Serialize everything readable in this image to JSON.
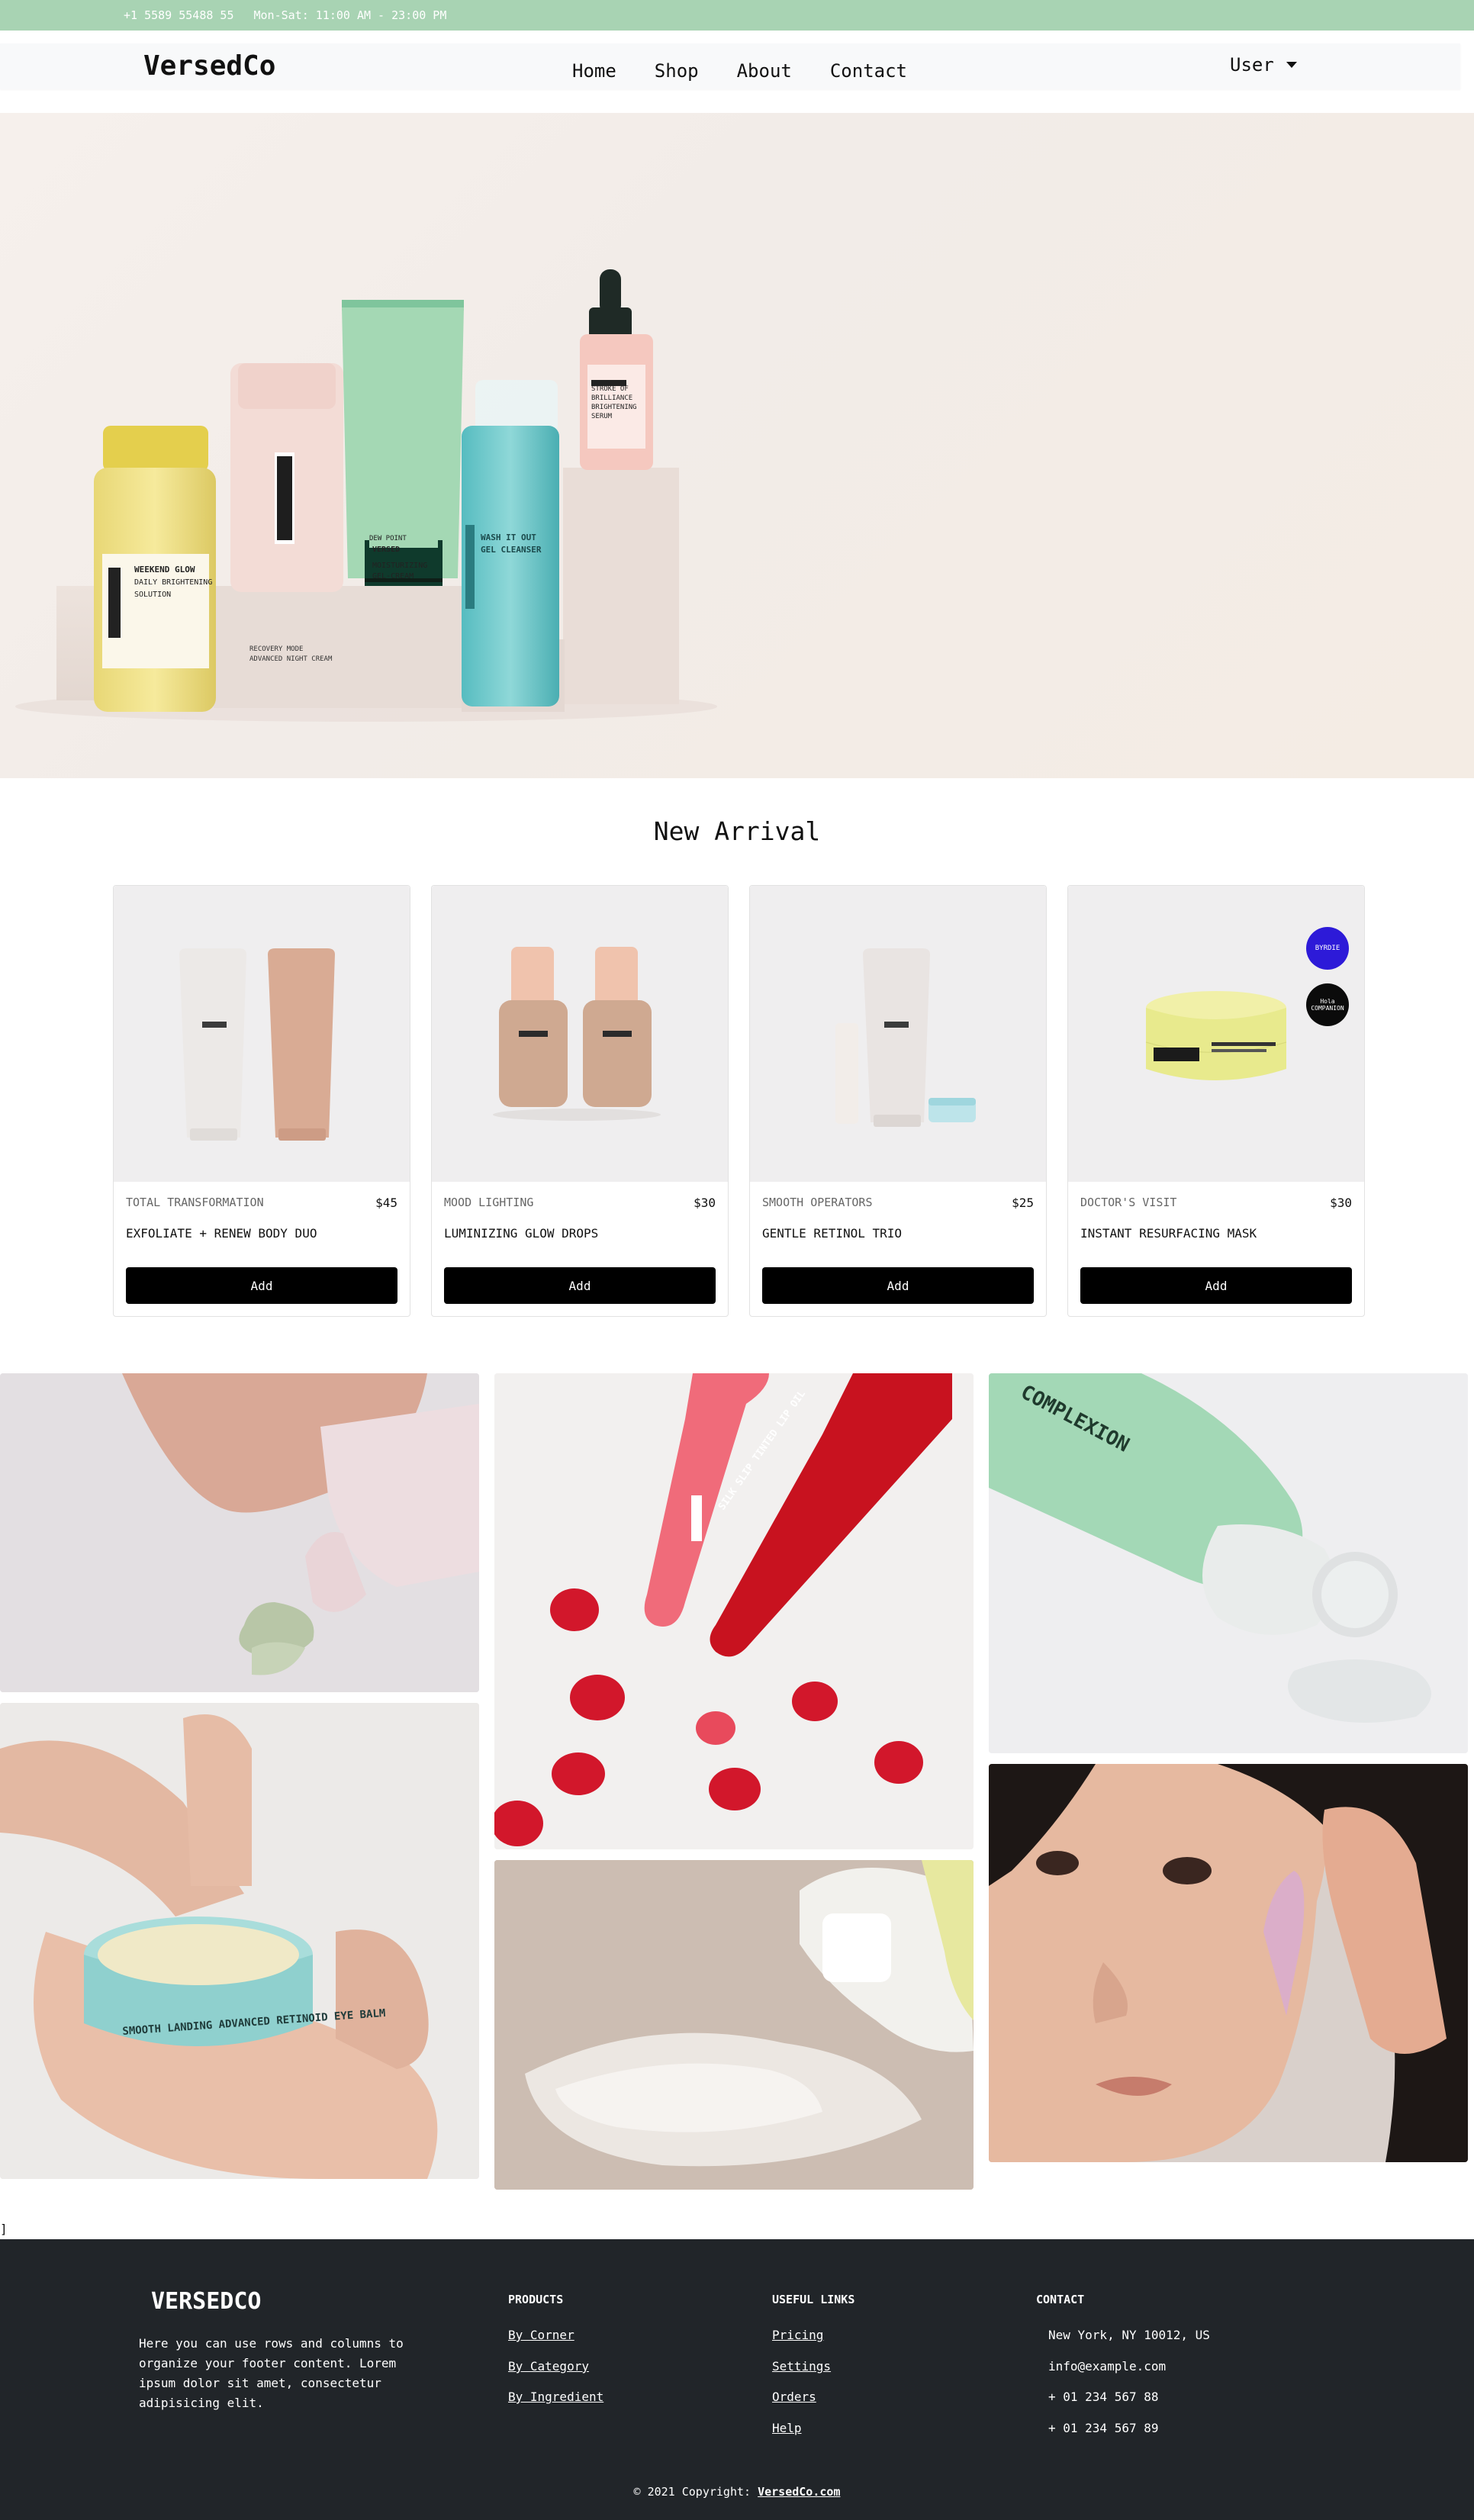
{
  "topbar": {
    "phone": "+1 5589 55488 55",
    "hours": "Mon-Sat: 11:00 AM - 23:00 PM"
  },
  "navbar": {
    "brand": "VersedCo",
    "links": [
      "Home",
      "Shop",
      "About",
      "Contact"
    ],
    "user_label": "User"
  },
  "new_arrival": {
    "title": "New Arrival",
    "products": [
      {
        "category": "TOTAL TRANSFORMATION",
        "price": "$45",
        "name": "EXFOLIATE + RENEW BODY DUO",
        "button": "Add"
      },
      {
        "category": "MOOD LIGHTING",
        "price": "$30",
        "name": "LUMINIZING GLOW DROPS",
        "button": "Add"
      },
      {
        "category": "SMOOTH OPERATORS",
        "price": "$25",
        "name": "GENTLE RETINOL TRIO",
        "button": "Add"
      },
      {
        "category": "DOCTOR'S VISIT",
        "price": "$30",
        "name": "INSTANT RESURFACING MASK",
        "button": "Add"
      }
    ]
  },
  "product_labels": {
    "brand": "VERSED",
    "hero_1": "WEEKEND GLOW DAILY BRIGHTENING SOLUTION",
    "hero_2": "RECOVERY MODE ADVANCED NIGHT CREAM",
    "hero_3": "DEW POINT MOISTURIZING GEL-CREAM",
    "hero_4": "WASH IT OUT GEL CLEANSER",
    "hero_5": "STROKE OF BRILLIANCE BRIGHTENING SERUM",
    "lip": "SILK SLIP TINTED LIP OIL",
    "eye_balm": "SMOOTH LANDING ADVANCED RETINOID EYE BALM",
    "complexion": "COMPLEXION",
    "mask_label": "INSTANT RESURFACING MASK",
    "award_1": "BYRDIE",
    "award_2": "Hola COMPANION"
  },
  "stray_text": "]",
  "footer": {
    "brand": "VERSEDCO",
    "about": "Here you can use rows and columns to organize your footer content. Lorem ipsum dolor sit amet, consectetur adipisicing elit.",
    "products_title": "PRODUCTS",
    "products": [
      "By Corner",
      "By Category",
      "By Ingredient"
    ],
    "useful_title": "USEFUL LINKS",
    "useful": [
      "Pricing",
      "Settings",
      "Orders",
      "Help"
    ],
    "contact_title": "CONTACT",
    "contact": [
      "New York, NY 10012, US",
      "info@example.com",
      "+ 01 234 567 88",
      "+ 01 234 567 89"
    ],
    "copyright_prefix": "© 2021 Copyright:",
    "copyright_link": "VersedCo.com"
  },
  "colors": {
    "topbar": "#a8d3b3",
    "footer": "#212529",
    "button": "#000000"
  }
}
